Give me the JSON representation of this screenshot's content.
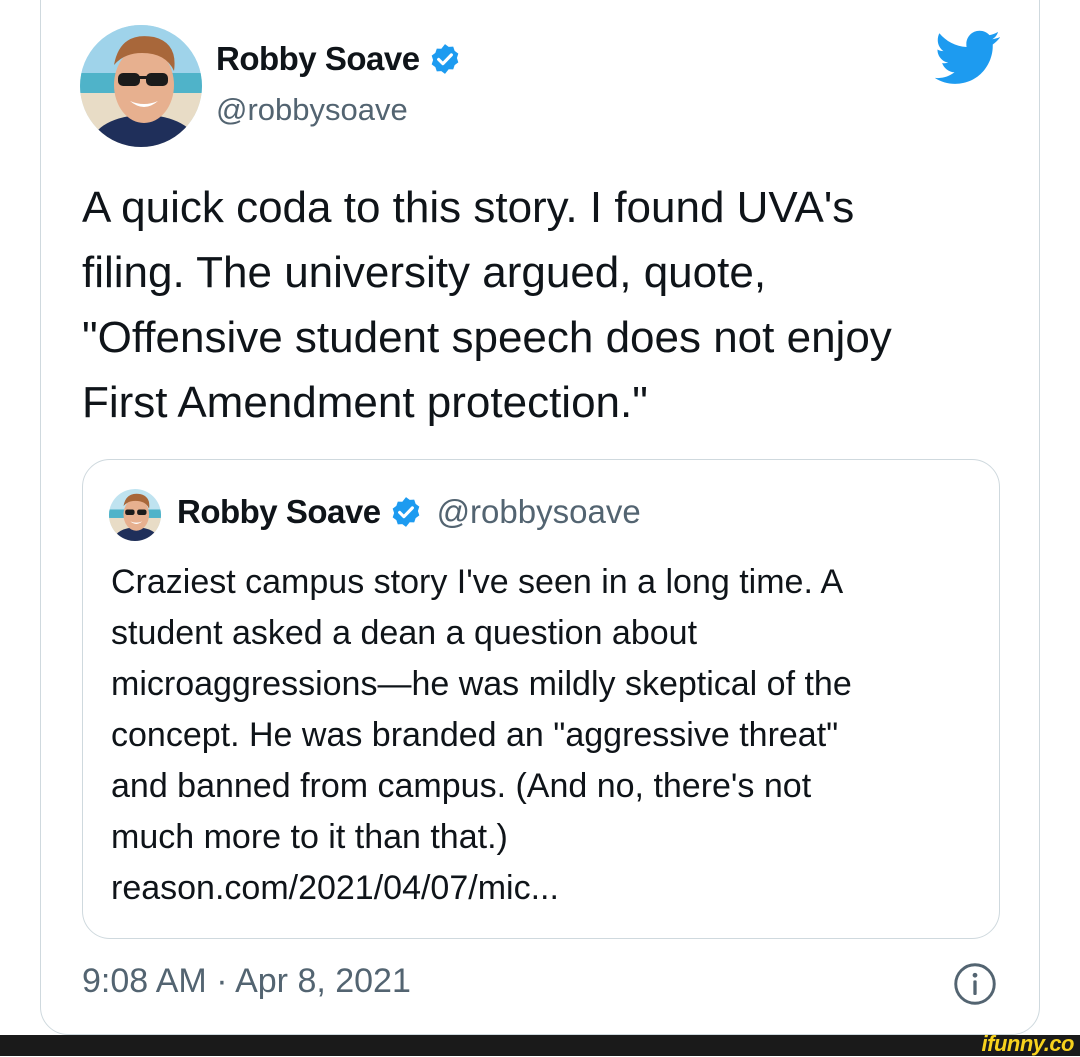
{
  "tweet": {
    "author_name": "Robby Soave",
    "author_handle": "@robbysoave",
    "text": "A quick coda to this story. I found UVA's\nfiling. The university argued, quote,\n\"Offensive student speech does not enjoy\nFirst Amendment protection.\"",
    "timestamp": "9:08 AM · Apr 8, 2021"
  },
  "quoted_tweet": {
    "author_name": "Robby Soave",
    "author_handle": "@robbysoave",
    "text": "Craziest campus story I've seen in a long time. A\nstudent asked a dean a question about\nmicroaggressions—he was mildly skeptical of the\nconcept. He was branded an \"aggressive threat\"\nand banned from campus. (And no, there's not\nmuch more to it than that.)\nreason.com/2021/04/07/mic..."
  },
  "watermark": "ifunny.co",
  "icons": {
    "verified": "verified-badge-icon",
    "bird": "twitter-bird-icon",
    "info": "info-icon"
  },
  "colors": {
    "twitter_blue": "#1d9bf0",
    "secondary_text": "#536471",
    "border": "#cfd9de"
  }
}
